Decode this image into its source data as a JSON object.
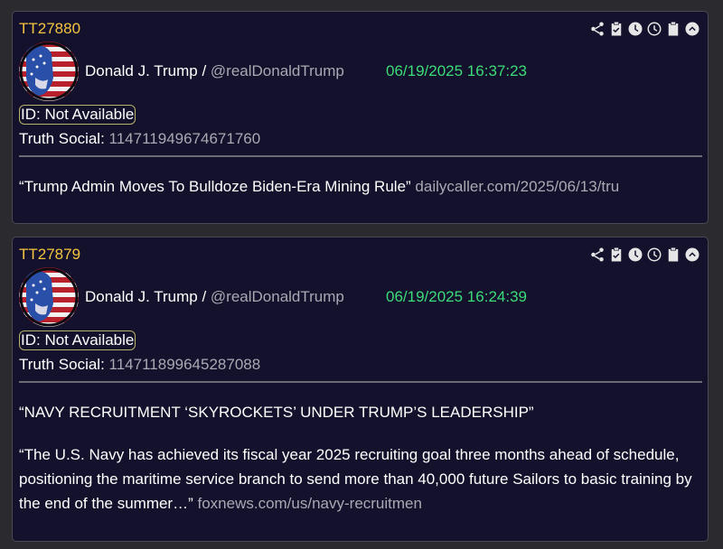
{
  "posts": [
    {
      "id": "TT27880",
      "author_name": "Donald J. Trump",
      "separator": " / ",
      "handle": "@realDonaldTrump",
      "timestamp": "06/19/2025 16:37:23",
      "id_badge": "ID: Not Available",
      "platform_label": "Truth Social:",
      "platform_id": "114711949674671760",
      "paragraphs": [
        {
          "text": "“Trump Admin Moves To Bulldoze Biden-Era Mining Rule” ",
          "link": "dailycaller.com/2025/06/13/tru"
        }
      ]
    },
    {
      "id": "TT27879",
      "author_name": "Donald J. Trump",
      "separator": " / ",
      "handle": "@realDonaldTrump",
      "timestamp": "06/19/2025 16:24:39",
      "id_badge": "ID: Not Available",
      "platform_label": "Truth Social:",
      "platform_id": "114711899645287088",
      "paragraphs": [
        {
          "text": "“NAVY RECRUITMENT ‘SKYROCKETS’ UNDER TRUMP’S LEADERSHIP”",
          "link": ""
        },
        {
          "text": "“The U.S. Navy has achieved its fiscal year 2025 recruiting goal three months ahead of schedule, positioning the maritime service branch to send more than 40,000 future Sailors to basic training by the end of the summer…” ",
          "link": "foxnews.com/us/navy-recruitmen"
        }
      ]
    }
  ],
  "action_icons": [
    "share-icon",
    "clipboard-check-icon",
    "clock-filled-icon",
    "clock-outline-icon",
    "clipboard-icon",
    "chevron-up-circle-icon"
  ],
  "colors": {
    "background": "#2b2b2f",
    "card": "#13112b",
    "post_id": "#f5c542",
    "timestamp": "#3ddc7a",
    "muted": "#a9a9b3"
  }
}
